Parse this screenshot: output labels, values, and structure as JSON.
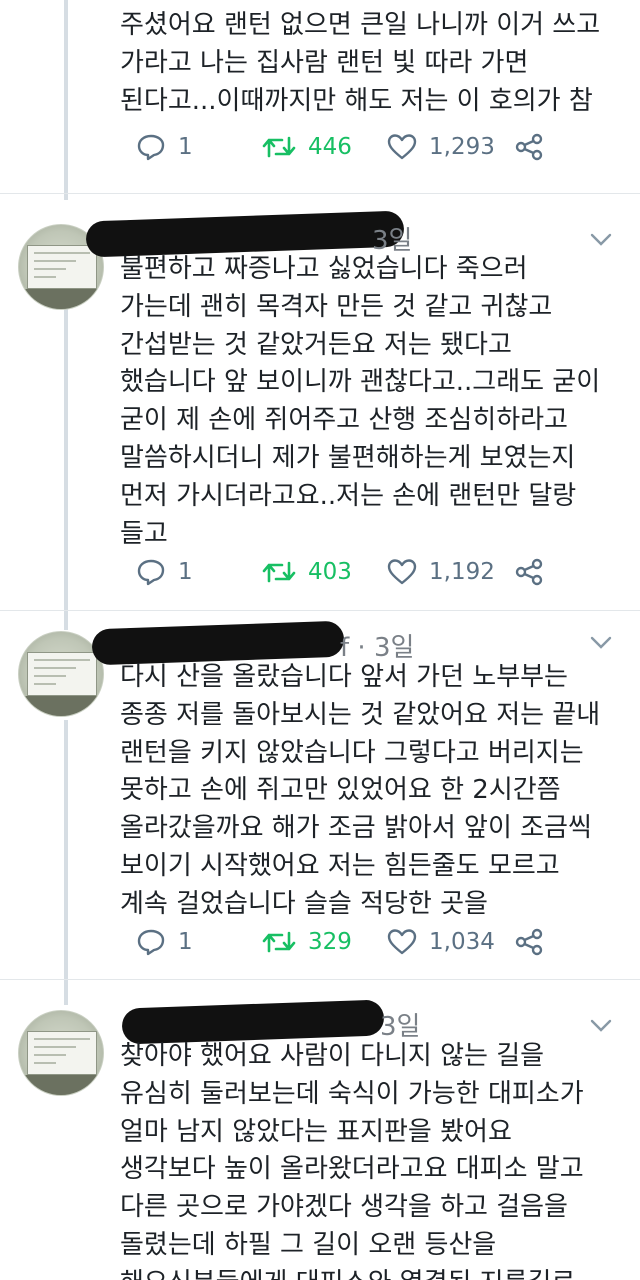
{
  "tweets": [
    {
      "handle_tail": "",
      "lines": [
        "주셨어요 랜턴 없으면 큰일 나니까 이거 쓰고",
        "가라고 나는 집사람 랜턴 빛 따라 가면",
        "된다고...이때까지만 해도 저는 이 호의가 참"
      ],
      "replies": "1",
      "retweets": "446",
      "likes": "1,293"
    },
    {
      "handle_tail": "3일",
      "lines": [
        "불편하고 짜증나고 싫었습니다 죽으러",
        "가는데 괜히 목격자 만든 것 같고 귀찮고",
        "간섭받는 것 같았거든요 저는 됐다고",
        "했습니다 앞 보이니까 괜찮다고..그래도 굳이",
        "굳이 제 손에 쥐어주고 산행 조심히하라고",
        "말씀하시더니 제가 불편해하는게 보였는지",
        "먼저 가시더라고요..저는 손에 랜턴만 달랑",
        "들고"
      ],
      "replies": "1",
      "retweets": "403",
      "likes": "1,192"
    },
    {
      "handle_tail": "f · 3일",
      "lines": [
        "다시 산을 올랐습니다 앞서 가던 노부부는",
        "종종 저를 돌아보시는 것 같았어요 저는 끝내",
        "랜턴을 키지 않았습니다 그렇다고 버리지는",
        "못하고 손에 쥐고만 있었어요 한 2시간쯤",
        "올라갔을까요 해가 조금 밝아서 앞이 조금씩",
        "보이기 시작했어요 저는 힘든줄도 모르고",
        "계속 걸었습니다 슬슬 적당한 곳을"
      ],
      "replies": "1",
      "retweets": "329",
      "likes": "1,034"
    },
    {
      "handle_tail": "3일",
      "lines": [
        "찾아야 했어요 사람이 다니지 않는 길을",
        "유심히 둘러보는데 숙식이 가능한 대피소가",
        "얼마 남지 않았다는 표지판을 봤어요",
        "생각보다 높이 올라왔더라고요 대피소 말고",
        "다른 곳으로 가야겠다 생각을 하고 걸음을",
        "돌렸는데 하필 그 길이 오랜 등산을",
        "해오신분들에게 대피소와 열결된 지름길로"
      ]
    }
  ],
  "icons": {
    "reply": "reply-bubble-icon",
    "retweet": "retweet-arrows-icon",
    "like": "heart-outline-icon",
    "share": "share-nodes-icon",
    "chevron": "chevron-down-icon"
  },
  "colors": {
    "retweet_active": "#17bf63",
    "action_gray": "#5b7083",
    "text": "#1d2227"
  }
}
